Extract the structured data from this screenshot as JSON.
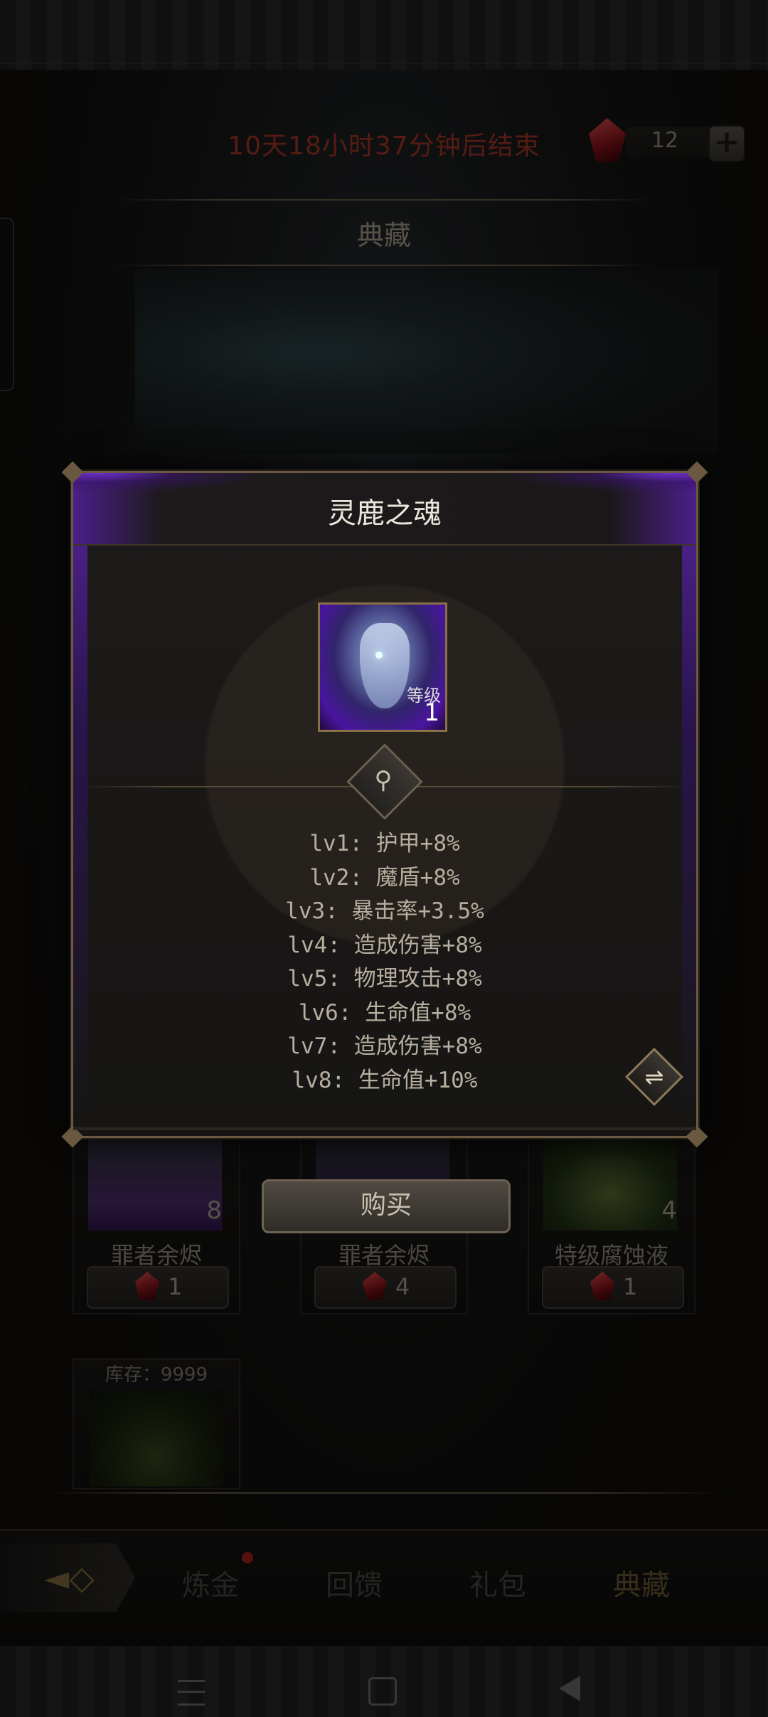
{
  "header": {
    "timer_text": "10天18小时37分钟后结束",
    "currency_value": "12",
    "add_label": "+"
  },
  "section": {
    "title": "典藏"
  },
  "cards": [
    {
      "name": "罪者余烬",
      "quantity": "8",
      "price": "1"
    },
    {
      "name": "罪者余烬",
      "quantity": "",
      "price": "4"
    },
    {
      "name": "特级腐蚀液",
      "quantity": "4",
      "price": "1"
    }
  ],
  "stock_card": {
    "stock_text": "库存：9999"
  },
  "modal": {
    "title": "灵鹿之魂",
    "level_label": "等级",
    "level_value": "1",
    "attributes": [
      "lv1: 护甲+8%",
      "lv2: 魔盾+8%",
      "lv3: 暴击率+3.5%",
      "lv4: 造成伤害+8%",
      "lv5: 物理攻击+8%",
      "lv6: 生命值+8%",
      "lv7: 造成伤害+8%",
      "lv8: 生命值+10%"
    ]
  },
  "buy_button": {
    "label": "购买"
  },
  "bottom_nav": {
    "items": [
      {
        "label": "炼金",
        "active": false,
        "badge": true
      },
      {
        "label": "回馈",
        "active": false,
        "badge": false
      },
      {
        "label": "礼包",
        "active": false,
        "badge": false
      },
      {
        "label": "典藏",
        "active": true,
        "badge": false
      }
    ]
  },
  "colors": {
    "timer": "#8a2e21",
    "accent_gold": "#8a7048",
    "purple": "#6c2fc7"
  },
  "icons": {
    "gem": "red-gem-icon",
    "magnify": "magnifier-icon",
    "scroll": "scroll-toggle-icon",
    "back": "back-arrow-icon"
  }
}
